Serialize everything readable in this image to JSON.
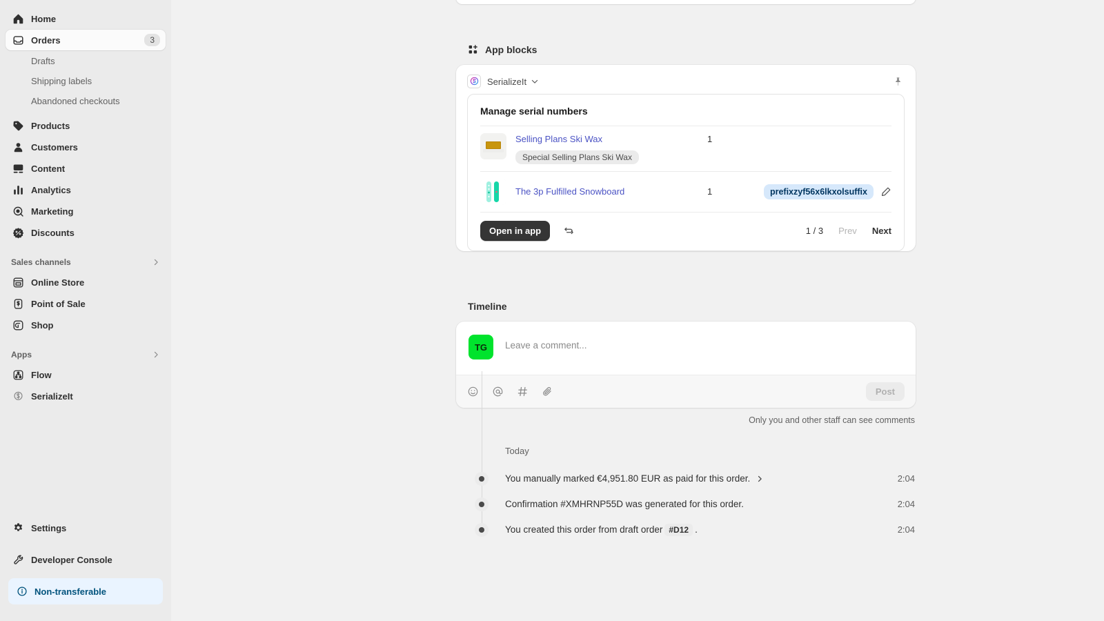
{
  "sidebar": {
    "nav": [
      {
        "label": "Home",
        "icon": "home-icon",
        "badge": ""
      },
      {
        "label": "Orders",
        "icon": "orders-icon",
        "badge": "3",
        "active": true
      }
    ],
    "order_subitems": [
      {
        "label": "Drafts"
      },
      {
        "label": "Shipping labels"
      },
      {
        "label": "Abandoned checkouts"
      }
    ],
    "nav2": [
      {
        "label": "Products",
        "icon": "tag-icon"
      },
      {
        "label": "Customers",
        "icon": "person-icon"
      },
      {
        "label": "Content",
        "icon": "content-icon"
      },
      {
        "label": "Analytics",
        "icon": "analytics-icon"
      },
      {
        "label": "Marketing",
        "icon": "marketing-icon"
      },
      {
        "label": "Discounts",
        "icon": "discount-icon"
      }
    ],
    "sales_channels_group": "Sales channels",
    "sales_channels": [
      {
        "label": "Online Store",
        "icon": "storefront-icon"
      },
      {
        "label": "Point of Sale",
        "icon": "pos-icon"
      },
      {
        "label": "Shop",
        "icon": "shop-icon"
      }
    ],
    "apps_group": "Apps",
    "apps": [
      {
        "label": "Flow",
        "icon": "flow-icon"
      },
      {
        "label": "SerializeIt",
        "icon": "serializeit-icon"
      }
    ],
    "bottom": [
      {
        "label": "Settings",
        "icon": "gear-icon"
      },
      {
        "label": "Developer Console",
        "icon": "wrench-icon"
      }
    ],
    "notice": {
      "label": "Non-transferable",
      "icon": "info-icon",
      "color": "#00527c",
      "bg": "#eaf4ff"
    }
  },
  "app_blocks": {
    "section_title": "App blocks",
    "section_icon": "app-blocks-icon",
    "app_name": "SerializeIt",
    "app_icon": "serializeit-app-icon",
    "chevron_icon": "chevron-down-icon",
    "pin_icon": "pin-icon",
    "inner_title": "Manage serial numbers",
    "rows": [
      {
        "product": "Selling Plans Ski Wax",
        "variant": "Special Selling Plans Ski Wax",
        "quantity": "1",
        "serial": "",
        "thumb": "ski-wax-thumbnail"
      },
      {
        "product": "The 3p Fulfilled Snowboard",
        "variant": "",
        "quantity": "1",
        "serial": "prefixzyf56x6lkxolsuffix",
        "thumb": "snowboard-thumbnail"
      }
    ],
    "open_in_app_label": "Open in app",
    "refresh_icon": "refresh-icon",
    "edit_icon": "pencil-icon",
    "page_count": "1 / 3",
    "prev_label": "Prev",
    "next_label": "Next"
  },
  "timeline": {
    "title": "Timeline",
    "avatar_initials": "TG",
    "avatar_color": "#00e32d",
    "comment_placeholder": "Leave a comment...",
    "toolbar_icons": [
      "emoji-icon",
      "mention-icon",
      "hashtag-icon",
      "attachment-icon"
    ],
    "post_label": "Post",
    "privacy_note": "Only you and other staff can see comments",
    "day_label": "Today",
    "events": [
      {
        "text": "You manually marked €4,951.80 EUR as paid for this order.",
        "has_chevron": true,
        "tag": "",
        "suffix": "",
        "time": "2:04"
      },
      {
        "text": "Confirmation #XMHRNP55D was generated for this order.",
        "has_chevron": false,
        "tag": "",
        "suffix": "",
        "time": "2:04"
      },
      {
        "text": "You created this order from draft order",
        "has_chevron": false,
        "tag": "#D12",
        "suffix": ".",
        "time": "2:04"
      }
    ]
  }
}
